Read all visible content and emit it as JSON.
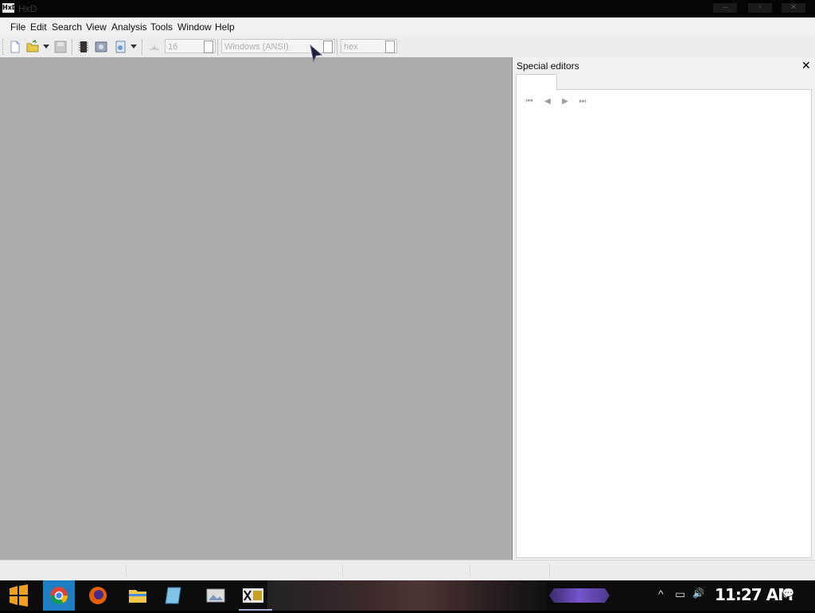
{
  "window": {
    "title": "HxD",
    "app_icon_text": "HxD",
    "controls": [
      "–",
      "▫",
      "✕"
    ]
  },
  "menu": {
    "items": [
      "File",
      "Edit",
      "Search",
      "View",
      "Analysis",
      "Tools",
      "Window",
      "Help"
    ]
  },
  "toolbar": {
    "bytes_per_row": "16",
    "charset": "Windows (ANSI)",
    "offset_base": "hex",
    "icons": [
      "new-file-icon",
      "open-file-icon",
      "dropdown-arrow-icon",
      "save-icon",
      "ram-icon",
      "disk-icon",
      "export-icon",
      "dropdown-arrow-icon",
      "jump-icon"
    ]
  },
  "side_panel": {
    "title": "Special editors",
    "close_symbol": "✕",
    "nav": [
      "⏮",
      "◀",
      "▶",
      "⏭"
    ]
  },
  "taskbar": {
    "clock": "11:27 AM",
    "apps": [
      "start-icon",
      "chrome-icon",
      "firefox-icon",
      "file-explorer-icon",
      "notepad-icon",
      "photos-icon",
      "hxd-icon"
    ],
    "tray": [
      "chevron-up-icon",
      "network-icon",
      "volume-icon",
      "notification-icon"
    ],
    "tray_symbols": [
      "^",
      "▭",
      "🔊",
      "💬"
    ]
  },
  "colors": {
    "titlebar": "#050505",
    "workspace": "#ababab",
    "panel": "#ffffff",
    "taskbar_accent": "#7755cc"
  }
}
